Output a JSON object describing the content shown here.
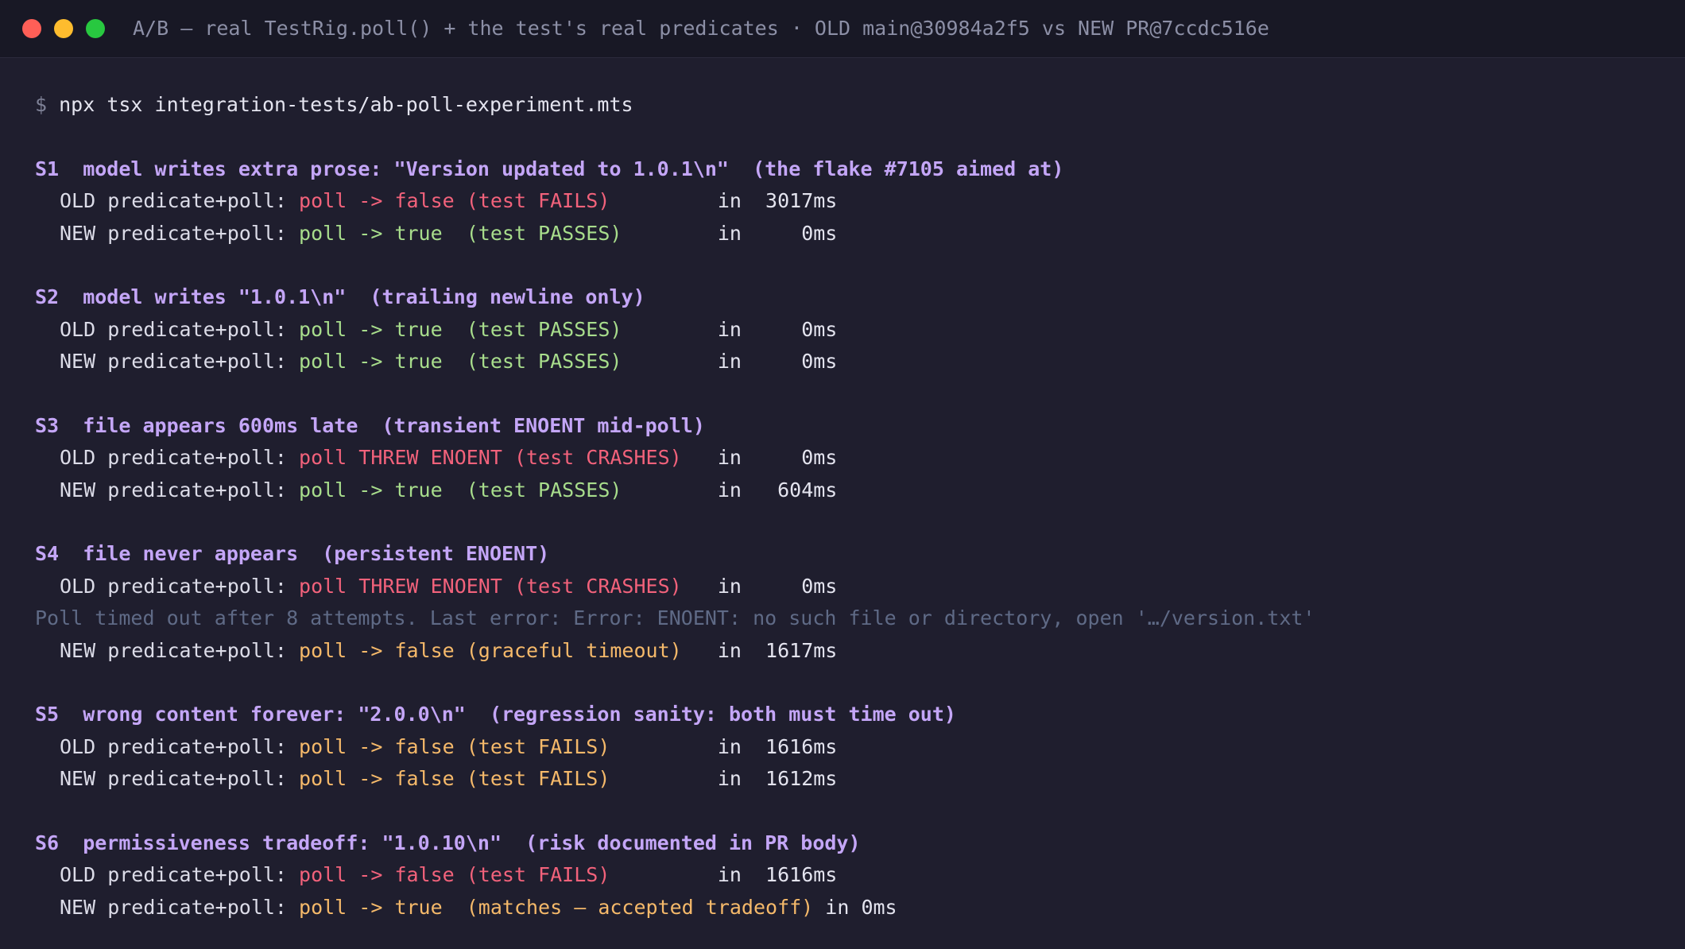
{
  "window": {
    "title": "A/B — real TestRig.poll() + the test's real predicates · OLD main@30984a2f5 vs NEW PR@7ccdc516e"
  },
  "prompt": "$ ",
  "command": "npx tsx integration-tests/ab-poll-experiment.mts",
  "scenarios": [
    {
      "header": "S1  model writes extra prose: \"Version updated to 1.0.1\\n\"  (the flake #7105 aimed at)",
      "rows": [
        {
          "label": "OLD predicate+poll: ",
          "result": "poll -> false (test FAILS)        ",
          "timing": " in  3017ms"
        },
        {
          "label": "NEW predicate+poll: ",
          "result": "poll -> true  (test PASSES)       ",
          "timing": " in     0ms"
        }
      ]
    },
    {
      "header": "S2  model writes \"1.0.1\\n\"  (trailing newline only)",
      "rows": [
        {
          "label": "OLD predicate+poll: ",
          "result": "poll -> true  (test PASSES)       ",
          "timing": " in     0ms"
        },
        {
          "label": "NEW predicate+poll: ",
          "result": "poll -> true  (test PASSES)       ",
          "timing": " in     0ms"
        }
      ]
    },
    {
      "header": "S3  file appears 600ms late  (transient ENOENT mid-poll)",
      "rows": [
        {
          "label": "OLD predicate+poll: ",
          "result": "poll THREW ENOENT (test CRASHES)  ",
          "timing": " in     0ms"
        },
        {
          "label": "NEW predicate+poll: ",
          "result": "poll -> true  (test PASSES)       ",
          "timing": " in   604ms"
        }
      ]
    },
    {
      "header": "S4  file never appears  (persistent ENOENT)",
      "rows": [
        {
          "label": "OLD predicate+poll: ",
          "result": "poll THREW ENOENT (test CRASHES)  ",
          "timing": " in     0ms"
        },
        {
          "label": "NEW predicate+poll: ",
          "result": "poll -> false (graceful timeout)  ",
          "timing": " in  1617ms"
        }
      ],
      "log": "Poll timed out after 8 attempts. Last error: Error: ENOENT: no such file or directory, open '…/version.txt'"
    },
    {
      "header": "S5  wrong content forever: \"2.0.0\\n\"  (regression sanity: both must time out)",
      "rows": [
        {
          "label": "OLD predicate+poll: ",
          "result": "poll -> false (test FAILS)        ",
          "timing": " in  1616ms"
        },
        {
          "label": "NEW predicate+poll: ",
          "result": "poll -> false (test FAILS)        ",
          "timing": " in  1612ms"
        }
      ]
    },
    {
      "header": "S6  permissiveness tradeoff: \"1.0.10\\n\"  (risk documented in PR body)",
      "rows": [
        {
          "label": "OLD predicate+poll: ",
          "result": "poll -> false (test FAILS)        ",
          "timing": " in  1616ms"
        },
        {
          "label": "NEW predicate+poll: ",
          "result": "poll -> true  (matches — accepted tradeoff)",
          "timing": " in 0ms"
        }
      ]
    }
  ],
  "colors": {
    "background": "#1f1e2e",
    "header": "#c4a6f7",
    "fail": "#f2627b",
    "pass": "#a8dd8c",
    "warn": "#f5b96a",
    "dim": "#5f6a86"
  }
}
